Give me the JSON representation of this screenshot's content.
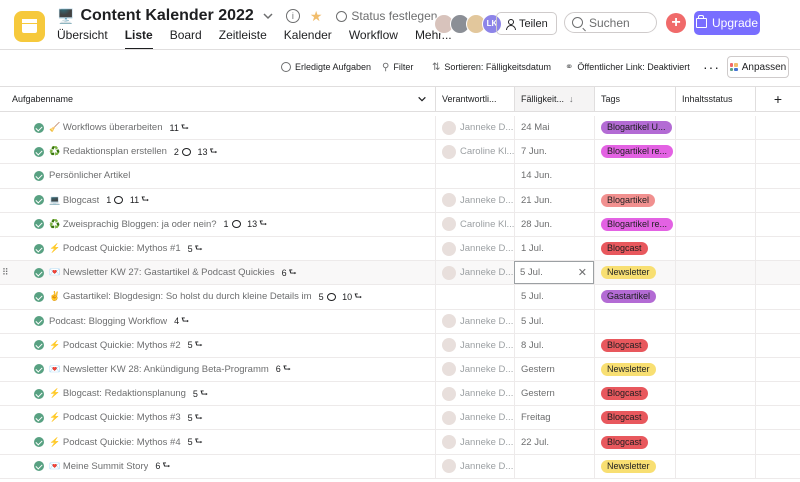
{
  "header": {
    "title_emoji": "🖥️",
    "title": "Content Kalender 2022",
    "status_label": "Status festlegen",
    "share_label": "Teilen",
    "search_placeholder": "Suchen",
    "upgrade_label": "Upgrade",
    "avatar_initials": "LK",
    "tabs": [
      "Übersicht",
      "Liste",
      "Board",
      "Zeitleiste",
      "Kalender",
      "Workflow",
      "Mehr..."
    ],
    "active_tab": "Liste"
  },
  "toolbar": {
    "completed_tasks": "Erledigte Aufgaben",
    "filter": "Filter",
    "sort": "Sortieren: Fälligkeitsdatum",
    "public_link": "Öffentlicher Link: Deaktiviert",
    "customize": "Anpassen"
  },
  "columns": {
    "name": "Aufgabenname",
    "assignee": "Verantwortli...",
    "due": "Fälligkeit...",
    "tags": "Tags",
    "content_status": "Inhaltsstatus",
    "add": "+"
  },
  "tag_colors": {
    "Blogartikel U...": "#b36bd4",
    "Blogartikel re...": "#e362e3",
    "Blogartikel": "#f1908f",
    "Blogcast": "#e8585d",
    "Newsletter": "#f8df72",
    "Gastartikel": "#b36bd4"
  },
  "rows": [
    {
      "emoji": "🧹",
      "name": "Workflows überarbeiten",
      "comments": "",
      "subtasks": "11",
      "assignee": "Janneke D...",
      "due": "24 Mai",
      "tag": "Blogartikel U..."
    },
    {
      "emoji": "♻️",
      "name": "Redaktionsplan erstellen",
      "comments": "2",
      "subtasks": "13",
      "assignee": "Caroline Kl...",
      "due": "7 Jun.",
      "tag": "Blogartikel re..."
    },
    {
      "emoji": "",
      "name": "Persönlicher Artikel",
      "comments": "",
      "subtasks": "",
      "assignee": "",
      "due": "14 Jun.",
      "tag": ""
    },
    {
      "emoji": "💻",
      "name": "Blogcast",
      "comments": "1",
      "subtasks": "11",
      "assignee": "Janneke D...",
      "due": "21 Jun.",
      "tag": "Blogartikel"
    },
    {
      "emoji": "♻️",
      "name": "Zweisprachig Bloggen: ja oder nein?",
      "comments": "1",
      "subtasks": "13",
      "assignee": "Caroline Kl...",
      "due": "28 Jun.",
      "tag": "Blogartikel re..."
    },
    {
      "emoji": "⚡",
      "name": "Podcast Quickie: Mythos #1",
      "comments": "",
      "subtasks": "5",
      "assignee": "Janneke D...",
      "due": "1 Jul.",
      "tag": "Blogcast"
    },
    {
      "emoji": "💌",
      "name": "Newsletter KW 27: Gastartikel & Podcast Quickies",
      "comments": "",
      "subtasks": "6",
      "assignee": "Janneke D...",
      "due": "5 Jul.",
      "tag": "Newsletter",
      "editing": true
    },
    {
      "emoji": "✌️",
      "name": "Gastartikel: Blogdesign: So holst du durch kleine Details im",
      "comments": "5",
      "subtasks": "10",
      "assignee": "",
      "due": "5 Jul.",
      "tag": "Gastartikel"
    },
    {
      "emoji": "",
      "name": "Podcast: Blogging Workflow",
      "comments": "",
      "subtasks": "4",
      "assignee": "Janneke D...",
      "due": "5 Jul.",
      "tag": ""
    },
    {
      "emoji": "⚡",
      "name": "Podcast Quickie: Mythos #2",
      "comments": "",
      "subtasks": "5",
      "assignee": "Janneke D...",
      "due": "8 Jul.",
      "tag": "Blogcast"
    },
    {
      "emoji": "💌",
      "name": "Newsletter KW 28: Ankündigung Beta-Programm",
      "comments": "",
      "subtasks": "6",
      "assignee": "Janneke D...",
      "due": "Gestern",
      "tag": "Newsletter"
    },
    {
      "emoji": "⚡",
      "name": "Blogcast: Redaktionsplanung",
      "comments": "",
      "subtasks": "5",
      "assignee": "Janneke D...",
      "due": "Gestern",
      "tag": "Blogcast"
    },
    {
      "emoji": "⚡",
      "name": "Podcast Quickie: Mythos #3",
      "comments": "",
      "subtasks": "5",
      "assignee": "Janneke D...",
      "due": "Freitag",
      "tag": "Blogcast"
    },
    {
      "emoji": "⚡",
      "name": "Podcast Quickie: Mythos #4",
      "comments": "",
      "subtasks": "5",
      "assignee": "Janneke D...",
      "due": "22 Jul.",
      "tag": "Blogcast"
    },
    {
      "emoji": "💌",
      "name": "Meine Summit Story",
      "comments": "",
      "subtasks": "6",
      "assignee": "Janneke D...",
      "due": "",
      "tag": "Newsletter"
    }
  ]
}
